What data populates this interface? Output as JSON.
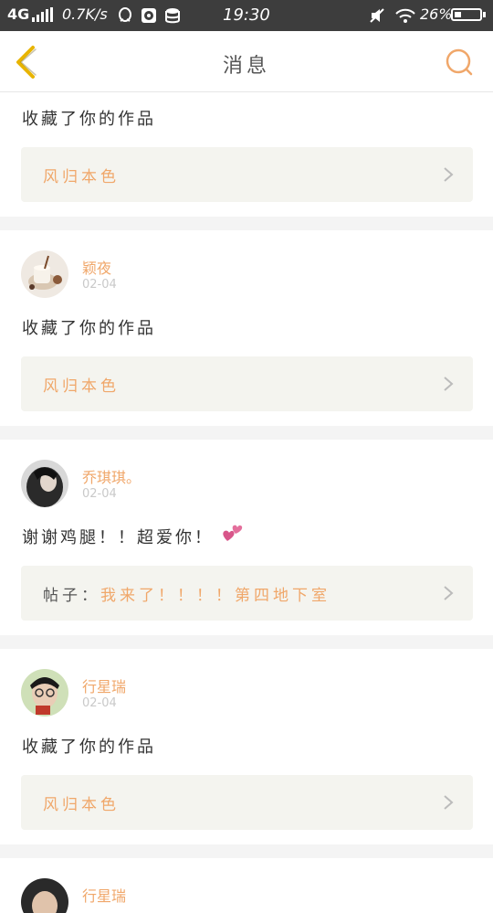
{
  "status_bar": {
    "network": "4G",
    "speed": "0.7K/s",
    "time": "19:30",
    "battery_percent": "26%",
    "battery_level": 0.26,
    "icons": [
      "qq-icon",
      "face-app-icon",
      "storage-icon",
      "mute-icon",
      "wifi-icon"
    ]
  },
  "nav": {
    "title": "消息",
    "back_icon": "chevron-left-icon",
    "search_icon": "search-icon"
  },
  "colors": {
    "accent": "#f0a76a",
    "back_arrow": "#e8b400",
    "link_bg": "#f4f4ef",
    "date": "#c9c9c9"
  },
  "messages": [
    {
      "message": "收藏了你的作品",
      "link_label": "风归本色"
    },
    {
      "user": "颖夜",
      "date": "02-04",
      "message": "收藏了你的作品",
      "link_label": "风归本色"
    },
    {
      "user": "乔琪琪。",
      "date": "02-04",
      "message": "谢谢鸡腿！！超爱你！",
      "link_prefix": "帖子：",
      "link_label": "我来了！！！！第四地下室"
    },
    {
      "user": "行星瑞",
      "date": "02-04",
      "message": "收藏了你的作品",
      "link_label": "风归本色"
    },
    {
      "user": "行星瑞"
    }
  ]
}
